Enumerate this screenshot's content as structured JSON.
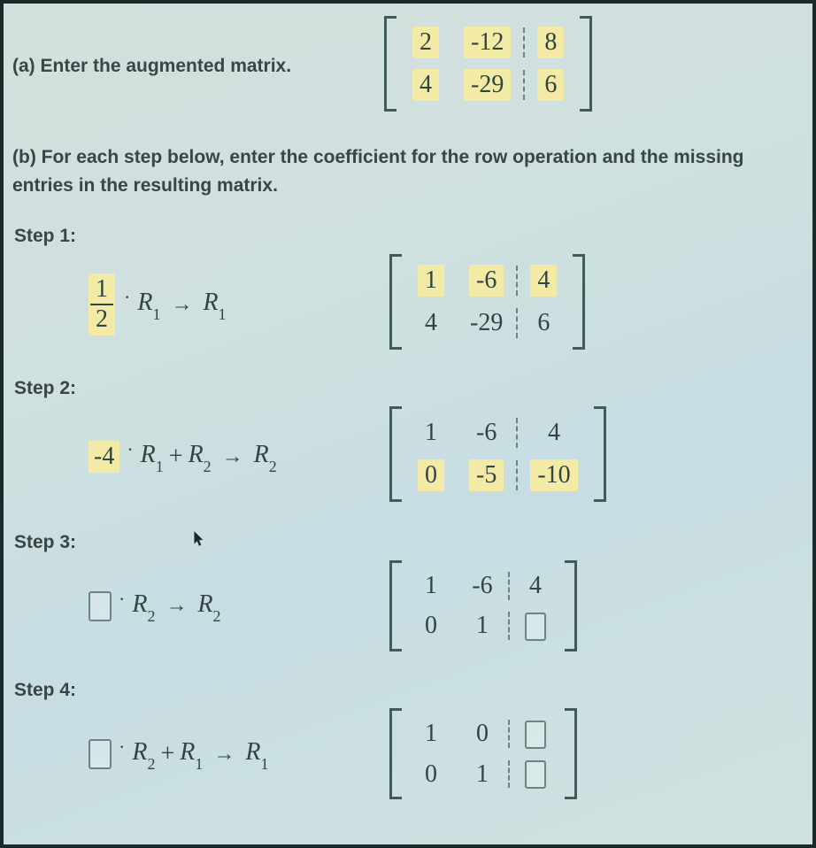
{
  "partA": {
    "label": "(a) Enter the augmented matrix.",
    "matrix": {
      "r1": {
        "c1": "2",
        "c2": "-12",
        "aug": "8"
      },
      "r2": {
        "c1": "4",
        "c2": "-29",
        "aug": "6"
      }
    }
  },
  "partB": {
    "label": "(b) For each step below, enter the coefficient for the row operation and the missing entries in the resulting matrix."
  },
  "steps": [
    {
      "label": "Step 1:",
      "op": {
        "type": "scale",
        "coef_num": "1",
        "coef_den": "2",
        "row": "R",
        "rowSub": "1",
        "target": "R",
        "targetSub": "1",
        "coefFilled": true
      },
      "matrix": {
        "r1": {
          "c1": "1",
          "c2": "-6",
          "aug": "4",
          "hl_c1": true,
          "hl_c2": true,
          "hl_aug": true
        },
        "r2": {
          "c1": "4",
          "c2": "-29",
          "aug": "6"
        }
      }
    },
    {
      "label": "Step 2:",
      "op": {
        "type": "addscale",
        "coef": "-4",
        "rowA": "R",
        "rowASub": "1",
        "rowB": "R",
        "rowBSub": "2",
        "target": "R",
        "targetSub": "2",
        "coefFilled": true
      },
      "matrix": {
        "r1": {
          "c1": "1",
          "c2": "-6",
          "aug": "4"
        },
        "r2": {
          "c1": "0",
          "c2": "-5",
          "aug": "-10",
          "hl_c1": true,
          "hl_c2": true,
          "hl_aug": true
        }
      }
    },
    {
      "label": "Step 3:",
      "op": {
        "type": "scale_box",
        "row": "R",
        "rowSub": "2",
        "target": "R",
        "targetSub": "2"
      },
      "matrix": {
        "r1": {
          "c1": "1",
          "c2": "-6",
          "aug": "4"
        },
        "r2": {
          "c1": "0",
          "c2": "1",
          "aug": "[]"
        }
      }
    },
    {
      "label": "Step 4:",
      "op": {
        "type": "addscale_box",
        "rowA": "R",
        "rowASub": "2",
        "rowB": "R",
        "rowBSub": "1",
        "target": "R",
        "targetSub": "1"
      },
      "matrix": {
        "r1": {
          "c1": "1",
          "c2": "0",
          "aug": "[]"
        },
        "r2": {
          "c1": "0",
          "c2": "1",
          "aug": "[]"
        }
      }
    }
  ],
  "chart_data": {
    "type": "table",
    "title": "Gaussian elimination on 2x3 augmented matrix",
    "initial_matrix": [
      [
        2,
        -12,
        8
      ],
      [
        4,
        -29,
        6
      ]
    ],
    "steps": [
      {
        "operation": "(1/2)*R1 -> R1",
        "result": [
          [
            1,
            -6,
            4
          ],
          [
            4,
            -29,
            6
          ]
        ]
      },
      {
        "operation": "-4*R1 + R2 -> R2",
        "result": [
          [
            1,
            -6,
            4
          ],
          [
            0,
            -5,
            -10
          ]
        ]
      },
      {
        "operation": "?*R2 -> R2",
        "result": [
          [
            1,
            -6,
            4
          ],
          [
            0,
            1,
            null
          ]
        ]
      },
      {
        "operation": "?*R2 + R1 -> R1",
        "result": [
          [
            1,
            0,
            null
          ],
          [
            0,
            1,
            null
          ]
        ]
      }
    ]
  }
}
